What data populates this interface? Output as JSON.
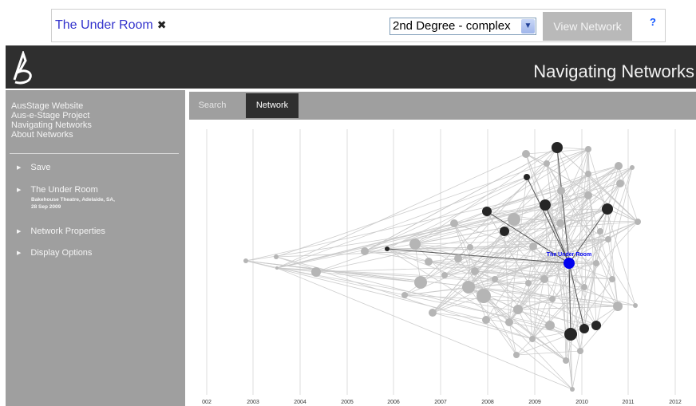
{
  "search": {
    "query": "The Under Room",
    "remove_symbol": "✖",
    "degree_selected": "2nd Degree - complex",
    "view_button": "View Network",
    "help": "?"
  },
  "header": {
    "title": "Navigating Networks"
  },
  "sidebar": {
    "links": [
      "AusStage Website",
      "Aus-e-Stage Project",
      "Navigating Networks",
      "About Networks"
    ],
    "items": [
      {
        "label": "Save"
      },
      {
        "label": "The Under Room",
        "sub1": "Bakehouse Theatre, Adelaide, SA,",
        "sub2": "28 Sep 2009"
      },
      {
        "label": "Network Properties"
      },
      {
        "label": "Display Options"
      }
    ]
  },
  "tabs": {
    "search": "Search",
    "network": "Network"
  },
  "graph": {
    "years": [
      "002",
      "2003",
      "2004",
      "2005",
      "2006",
      "2007",
      "2008",
      "2009",
      "2010",
      "2011",
      "2012"
    ],
    "focus_label": "The Under Room",
    "colors": {
      "background": "#ffffff",
      "gridline": "#dddddd",
      "edge": "#c8c8c8",
      "node": "#b5b5b5",
      "dark_node": "#262626",
      "focus": "#0000ee"
    }
  }
}
